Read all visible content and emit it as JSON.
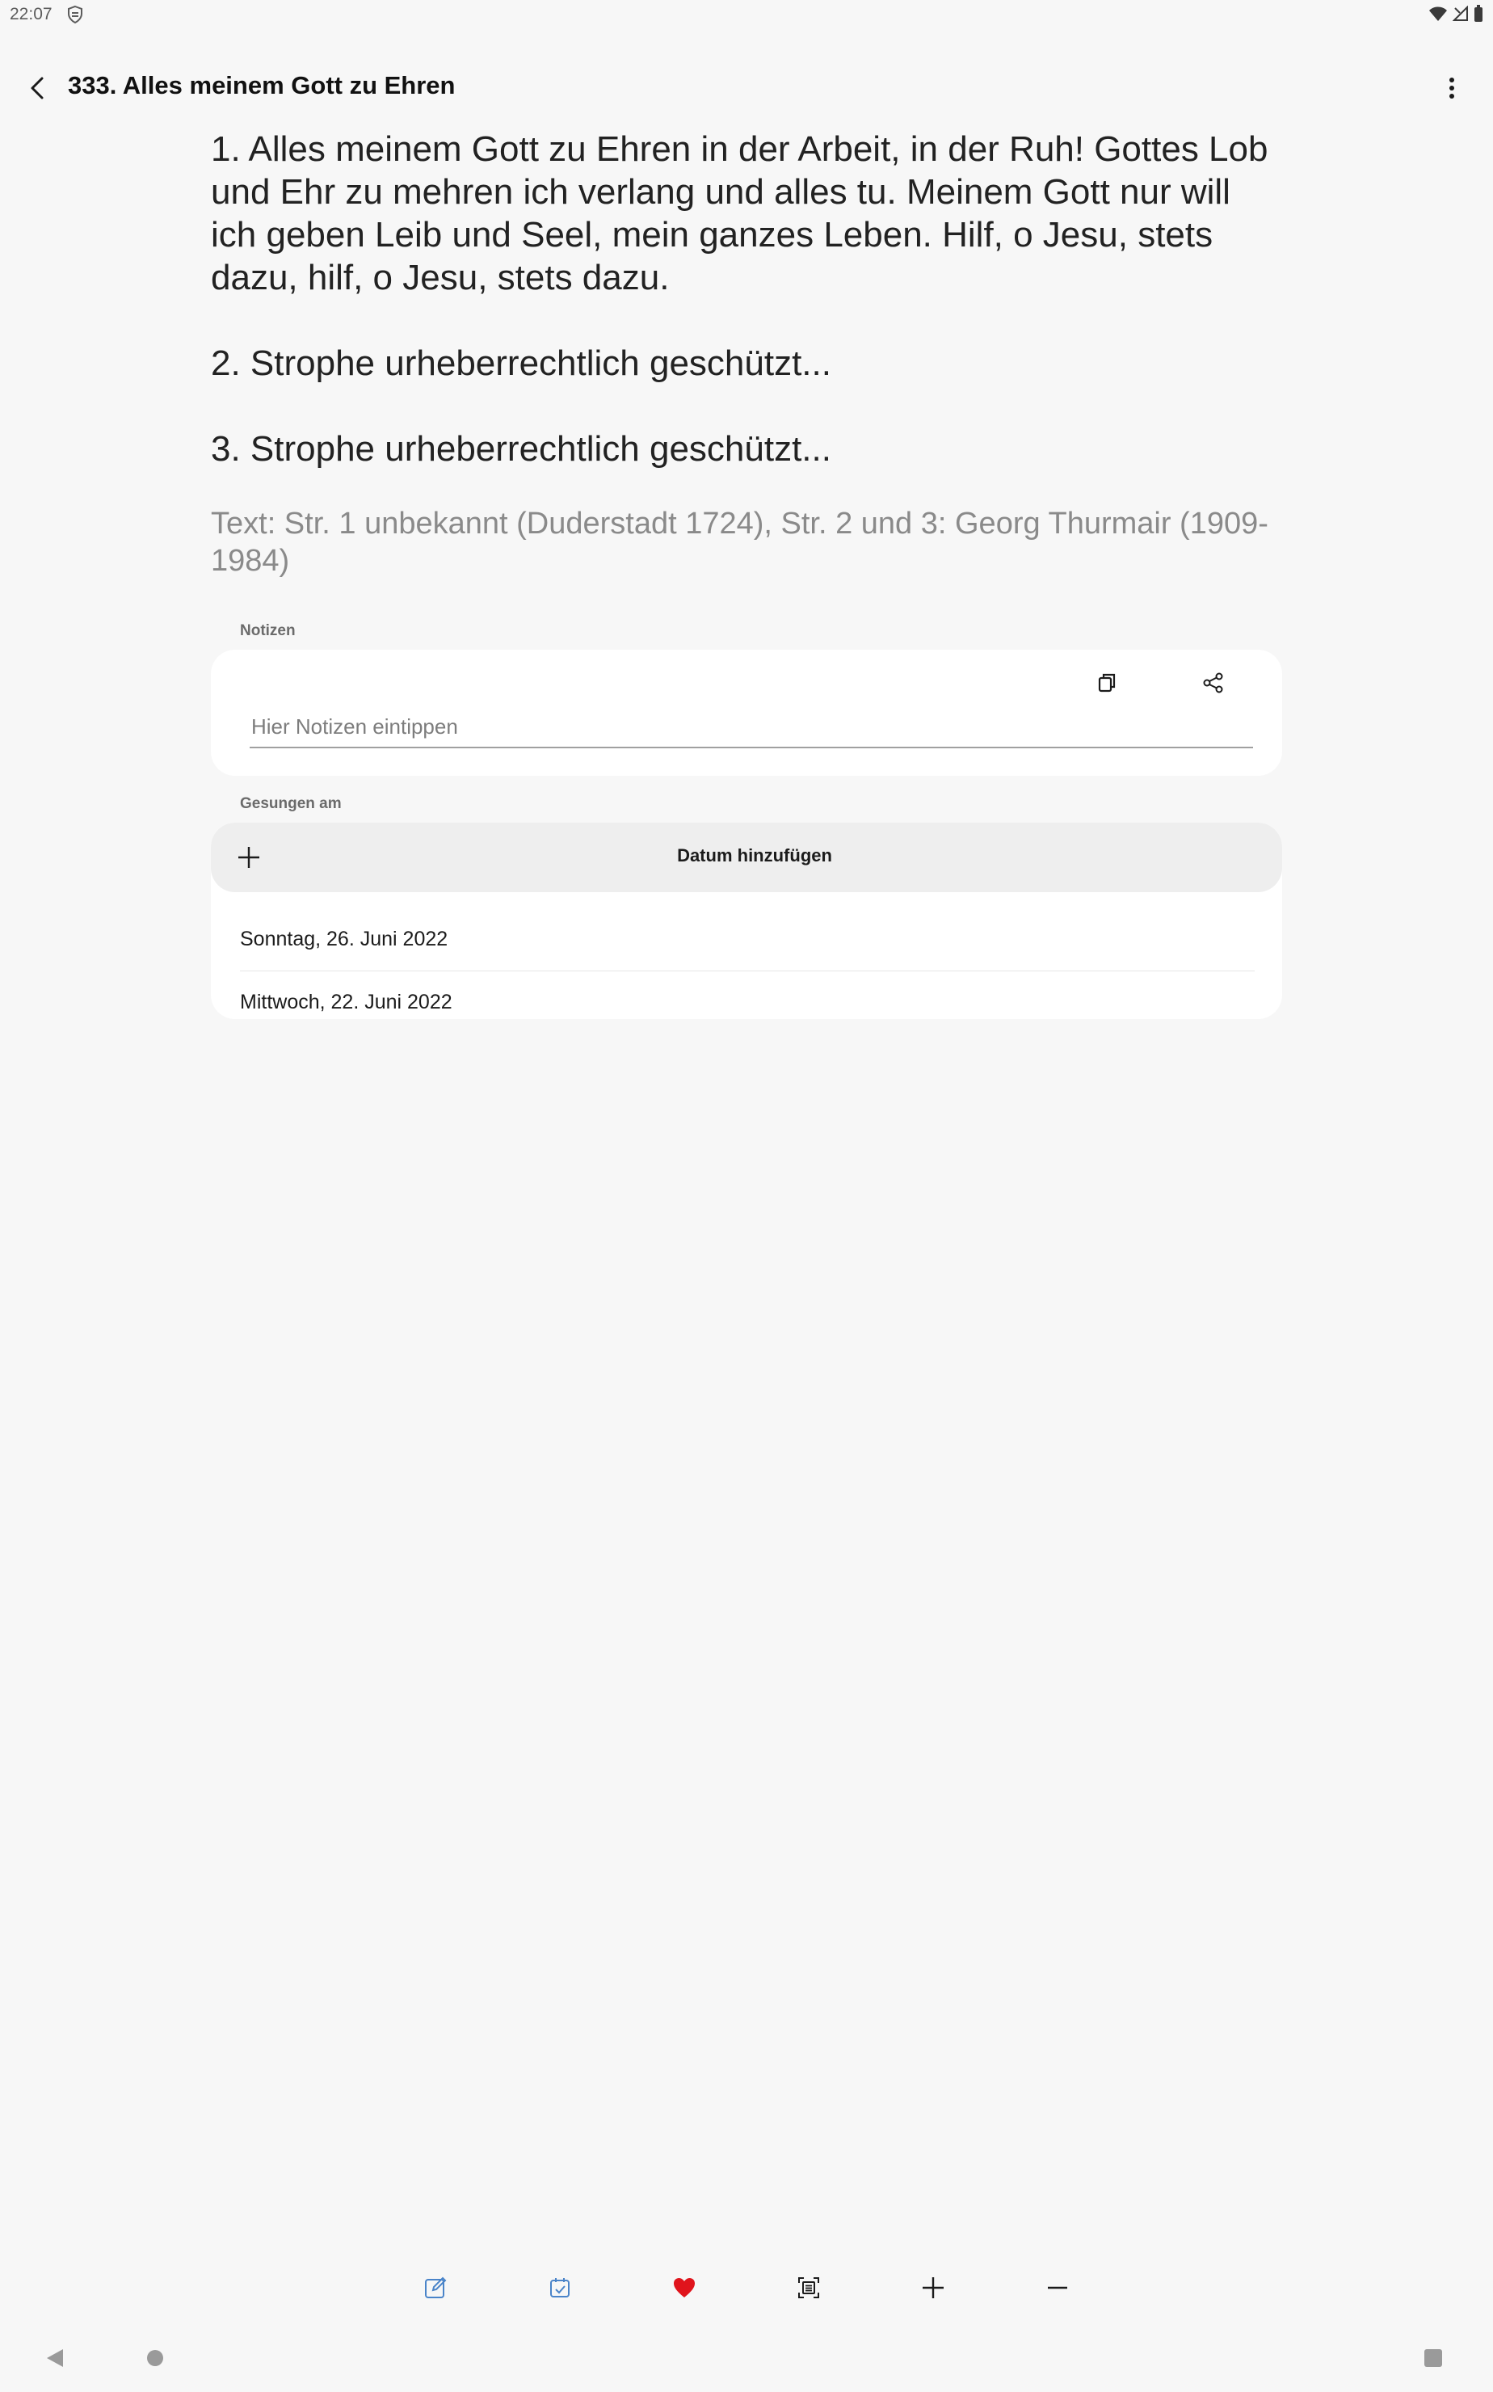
{
  "status_bar": {
    "time": "22:07",
    "icons": [
      "shield-icon",
      "wifi-icon",
      "signal-icon",
      "battery-icon"
    ]
  },
  "app_bar": {
    "title": "333. Alles meinem Gott zu Ehren",
    "back_icon": "chevron-left-icon",
    "more_icon": "more-vert-icon"
  },
  "lyrics": {
    "verses": [
      "1. Alles meinem Gott zu Ehren in der Arbeit, in der Ruh! Gottes Lob und Ehr zu mehren ich verlang und alles tu. Meinem Gott nur will ich geben Leib und Seel, mein ganzes Leben. Hilf, o Jesu, stets dazu, hilf, o Jesu, stets dazu.",
      "2. Strophe urheberrechtlich geschützt...",
      "3. Strophe urheberrechtlich geschützt..."
    ],
    "source": "Text: Str. 1 unbekannt (Duderstadt 1724), Str. 2 und 3: Georg Thurmair (1909-1984)"
  },
  "notes": {
    "label": "Notizen",
    "placeholder": "Hier Notizen eintippen",
    "value": "",
    "actions": [
      "copy-icon",
      "share-icon"
    ]
  },
  "sung": {
    "label": "Gesungen am",
    "add_label": "Datum hinzufügen",
    "dates": [
      "Sonntag, 26. Juni 2022",
      "Mittwoch, 22. Juni 2022"
    ]
  },
  "toolbar": {
    "items": [
      "edit-icon",
      "calendar-check-icon",
      "favorite-heart-icon",
      "fullscreen-text-icon",
      "zoom-in-plus-icon",
      "zoom-out-minus-icon"
    ]
  },
  "colors": {
    "background": "#f7f7f7",
    "card": "#ffffff",
    "heart": "#e0141c",
    "toolbar_blue": "#4a84c9",
    "muted_text": "#8a8a8a"
  }
}
